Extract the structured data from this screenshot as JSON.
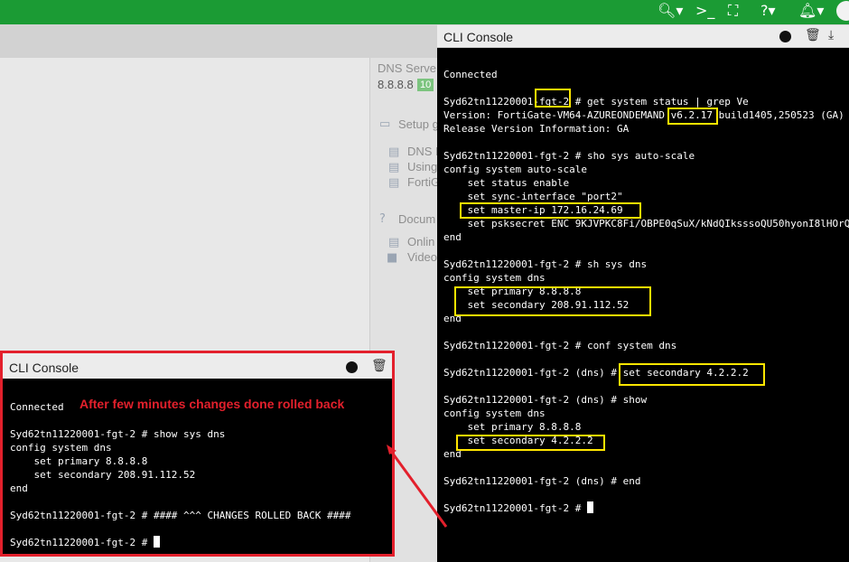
{
  "topbar": {
    "icons": [
      "search-icon",
      "terminal-icon",
      "fullscreen-icon",
      "help-icon",
      "bell-icon",
      "user-avatar"
    ]
  },
  "background": {
    "dns_servers_label": "DNS Serve",
    "dns_value": "8.8.8.8",
    "dns_badge": "10",
    "setup_label": "Setup g",
    "links_1": [
      "DNS I",
      "Using",
      "FortiG"
    ],
    "docs_label": "Docum",
    "links_2": [
      "Onlin",
      "Video"
    ]
  },
  "main_console": {
    "title": "CLI Console",
    "lines": [
      "Connected",
      "",
      "Syd62tn11220001-fgt-2 # get system status | grep Ve",
      "Version: FortiGate-VM64-AZUREONDEMAND v6.2.17 build1405,250523 (GA)",
      "Release Version Information: GA",
      "",
      "Syd62tn11220001-fgt-2 # sho sys auto-scale",
      "config system auto-scale",
      "    set status enable",
      "    set sync-interface \"port2\"",
      "    set master-ip 172.16.24.69",
      "    set psksecret ENC 9KJVPKC8Fi/OBPE0qSuX/kNdQIksssoQU50hyonI8lHOrQ",
      "end",
      "",
      "Syd62tn11220001-fgt-2 # sh sys dns",
      "config system dns",
      "    set primary 8.8.8.8",
      "    set secondary 208.91.112.52",
      "end",
      "",
      "Syd62tn11220001-fgt-2 # conf system dns",
      "",
      "Syd62tn11220001-fgt-2 (dns) # set secondary 4.2.2.2",
      "",
      "Syd62tn11220001-fgt-2 (dns) # show",
      "config system dns",
      "    set primary 8.8.8.8",
      "    set secondary 4.2.2.2",
      "end",
      "",
      "Syd62tn11220001-fgt-2 (dns) # end",
      "",
      "Syd62tn11220001-fgt-2 # "
    ]
  },
  "popup_console": {
    "title": "CLI Console",
    "annotation": "After few minutes changes done rolled back",
    "lines": [
      "Connected",
      "",
      "Syd62tn11220001-fgt-2 # show sys dns",
      "config system dns",
      "    set primary 8.8.8.8",
      "    set secondary 208.91.112.52",
      "end",
      "",
      "Syd62tn11220001-fgt-2 # #### ^^^ CHANGES ROLLED BACK ####",
      "",
      "Syd62tn11220001-fgt-2 # "
    ]
  },
  "colors": {
    "topbar": "#1b9b34",
    "highlight": "#ffe600",
    "annotation": "#e3202c",
    "terminal_bg": "#000000"
  }
}
